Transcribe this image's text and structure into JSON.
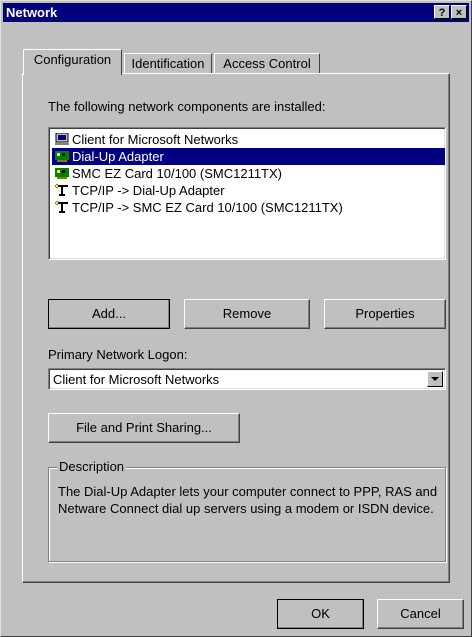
{
  "window": {
    "title": "Network",
    "help_button": "?",
    "close_button": "×"
  },
  "tabs": [
    {
      "label": "Configuration",
      "active": true
    },
    {
      "label": "Identification",
      "active": false
    },
    {
      "label": "Access Control",
      "active": false
    }
  ],
  "components": {
    "label": "The following network components are installed:",
    "items": [
      {
        "label": "Client for Microsoft Networks",
        "icon": "client-icon",
        "selected": false
      },
      {
        "label": "Dial-Up Adapter",
        "icon": "adapter-icon",
        "selected": true
      },
      {
        "label": "SMC EZ Card 10/100 (SMC1211TX)",
        "icon": "adapter-icon",
        "selected": false
      },
      {
        "label": "TCP/IP -> Dial-Up Adapter",
        "icon": "protocol-icon",
        "selected": false
      },
      {
        "label": "TCP/IP -> SMC EZ Card 10/100 (SMC1211TX)",
        "icon": "protocol-icon",
        "selected": false
      }
    ]
  },
  "buttons": {
    "add": "Add...",
    "remove": "Remove",
    "properties": "Properties",
    "file_print_sharing": "File and Print Sharing...",
    "ok": "OK",
    "cancel": "Cancel"
  },
  "logon": {
    "label": "Primary Network Logon:",
    "value": "Client for Microsoft Networks"
  },
  "description": {
    "title": "Description",
    "text": "The Dial-Up Adapter lets your computer connect to PPP, RAS and Netware Connect dial up servers using a modem or ISDN device."
  },
  "colors": {
    "titlebar": "#000080",
    "face": "#c0c0c0",
    "selection": "#000080"
  }
}
